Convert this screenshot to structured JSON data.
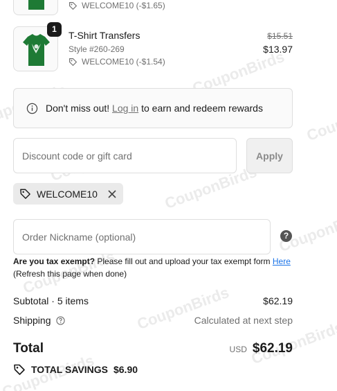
{
  "items": [
    {
      "discount": "WELCOME10 (-$1.65)"
    },
    {
      "quantity": "1",
      "title": "T-Shirt Transfers",
      "style": "Style #260-269",
      "discount": "WELCOME10 (-$1.54)",
      "price_original": "$15.51",
      "price_final": "$13.97"
    }
  ],
  "rewards_notice": {
    "before": "Don't miss out!",
    "link": "Log in",
    "after": "to earn and redeem rewards",
    "icon": "info-icon"
  },
  "discount_form": {
    "placeholder": "Discount code or gift card",
    "apply_label": "Apply"
  },
  "applied_code": {
    "code": "WELCOME10",
    "tag_icon": "tag-icon",
    "remove_icon": "close-icon"
  },
  "nickname": {
    "placeholder": "Order Nickname (optional)",
    "help_icon": "question-icon",
    "help_symbol": "?"
  },
  "tax_notice": {
    "bold": "Are you tax exempt?",
    "text": "Please fill out and upload your tax exempt form",
    "link": "Here",
    "note": "(Refresh this page when done)"
  },
  "summary": {
    "subtotal_label": "Subtotal · 5 items",
    "subtotal_value": "$62.19",
    "shipping_label": "Shipping",
    "shipping_value": "Calculated at next step",
    "total_label": "Total",
    "currency": "USD",
    "total_value": "$62.19",
    "savings_label": "TOTAL SAVINGS",
    "savings_value": "$6.90"
  },
  "watermark_text": "CouponBirds",
  "colors": {
    "shirt_green": "#1e7a35",
    "link_blue": "#1a73e8"
  }
}
